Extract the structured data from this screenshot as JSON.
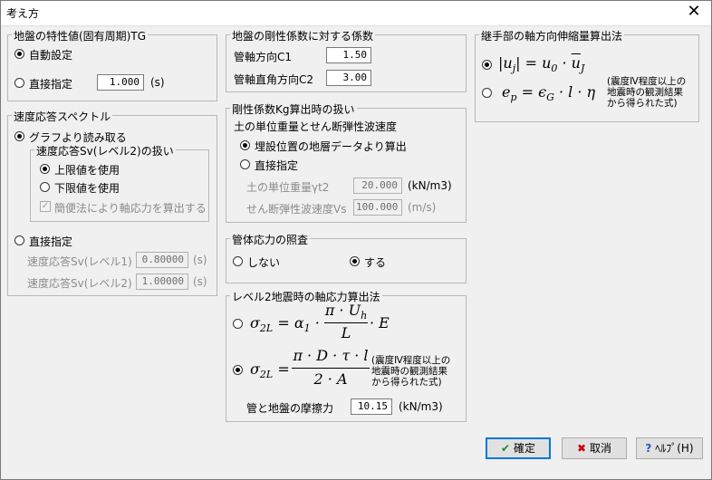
{
  "window": {
    "title": "考え方"
  },
  "ground_char": {
    "title": "地盤の特性値(固有周期)TG",
    "auto_label": "自動設定",
    "direct_label": "直接指定",
    "direct_value": "1.000",
    "direct_unit": "(s)"
  },
  "velocity_spectrum": {
    "title": "速度応答スペクトル",
    "graph_label": "グラフより読み取る",
    "sv_group_title": "速度応答Sv(レベル2)の扱い",
    "upper_label": "上限値を使用",
    "lower_label": "下限値を使用",
    "simple_label": "簡便法により軸応力を算出する",
    "direct_label": "直接指定",
    "sv1_label": "速度応答Sv(レベル1)",
    "sv1_value": "0.80000",
    "sv1_unit": "(s)",
    "sv2_label": "速度応答Sv(レベル2)",
    "sv2_value": "1.00000",
    "sv2_unit": "(s)"
  },
  "stiffness": {
    "title": "地盤の剛性係数に対する係数",
    "c1_label": "管軸方向C1",
    "c1_value": "1.50",
    "c2_label": "管軸直角方向C2",
    "c2_value": "3.00"
  },
  "kg_calc": {
    "title": "剛性係数Kg算出時の扱い",
    "subtitle": "土の単位重量とせん断弾性波速度",
    "layer_label": "埋設位置の地層データより算出",
    "direct_label": "直接指定",
    "gamma_label": "土の単位重量γt2",
    "gamma_value": "20.000",
    "gamma_unit": "(kN/m3)",
    "vs_label": "せん断弾性波速度Vs",
    "vs_value": "100.000",
    "vs_unit": "(m/s)"
  },
  "pipe_stress": {
    "title": "管体応力の照査",
    "no_label": "しない",
    "yes_label": "する"
  },
  "level2": {
    "title": "レベル2地震時の軸応力算出法",
    "note": [
      "(震度Ⅳ程度以上の",
      "地震時の観測結果",
      "から得られた式)"
    ],
    "friction_label": "管と地盤の摩擦力",
    "friction_value": "10.15",
    "friction_unit": "(kN/m3)"
  },
  "joint": {
    "title": "継手部の軸方向伸縮量算出法",
    "note": [
      "(震度Ⅳ程度以上の",
      "地震時の観測結果",
      "から得られた式)"
    ]
  },
  "buttons": {
    "ok": "確定",
    "cancel": "取消",
    "help": "ﾍﾙﾌﾟ(H)"
  }
}
